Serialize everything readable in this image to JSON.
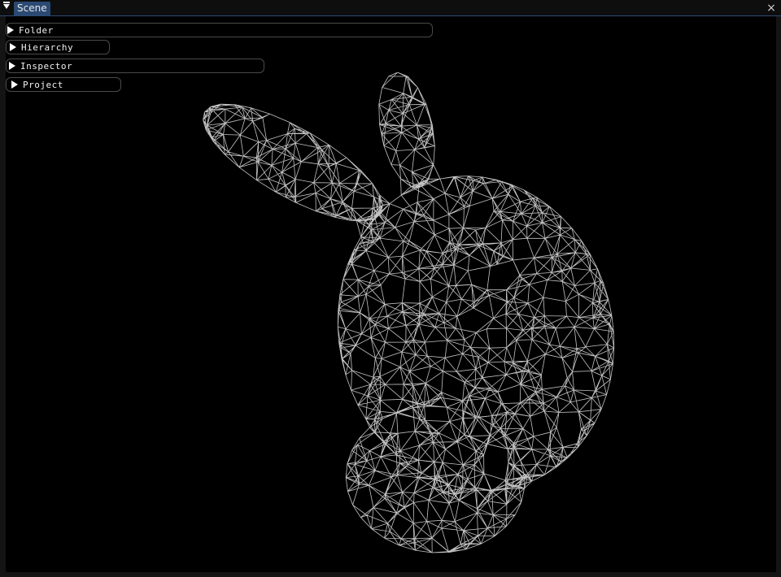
{
  "window": {
    "tab_label": "Scene",
    "close_glyph": "×"
  },
  "panels": [
    {
      "label": "Folder",
      "icon": "collapsed-triangle-icon"
    },
    {
      "label": "Hierarchy",
      "icon": "collapsed-triangle-icon"
    },
    {
      "label": "Inspector",
      "icon": "collapsed-triangle-icon"
    },
    {
      "label": "Project",
      "icon": "collapsed-triangle-icon"
    }
  ],
  "scene": {
    "model": "wireframe-bunny",
    "wire_color": "#d9d9d9",
    "background": "#000000"
  },
  "colors": {
    "accent": "#2b4a73",
    "titlebar": "#0e0e0e",
    "panel_border": "#4a4a4a"
  }
}
